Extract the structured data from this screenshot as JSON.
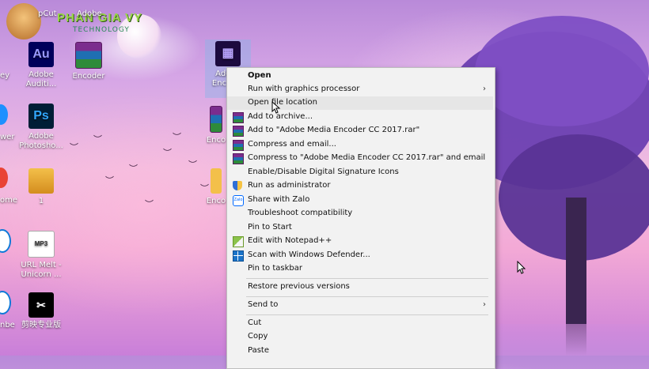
{
  "watermark": {
    "title": "PHAN GIA VY",
    "subtitle": "TECHNOLOGY"
  },
  "desktop_icons": [
    {
      "label": "pCut"
    },
    {
      "label": "Adobe"
    },
    {
      "label": "Adobe Auditi..."
    },
    {
      "label": "Encoder"
    },
    {
      "label": "Adobe Encod..."
    },
    {
      "label": "Adobe Photosho..."
    },
    {
      "label": "Enco"
    },
    {
      "label": "1"
    },
    {
      "label": "Enco"
    },
    {
      "label": "URL Melt - Unicorn ..."
    },
    {
      "label": "剪映专业版"
    },
    {
      "label": "ey"
    },
    {
      "label": "wer"
    },
    {
      "label": "ome"
    },
    {
      "label": "nbe"
    }
  ],
  "context_menu": {
    "items": [
      {
        "label": "Open",
        "icon": "",
        "bold": true
      },
      {
        "label": "Run with graphics processor",
        "icon": "",
        "submenu": true
      },
      {
        "label": "Open file location",
        "icon": "",
        "hover": true
      },
      {
        "label": "Add to archive...",
        "icon": "winrar-icon"
      },
      {
        "label": "Add to \"Adobe Media Encoder CC 2017.rar\"",
        "icon": "winrar-icon"
      },
      {
        "label": "Compress and email...",
        "icon": "winrar-icon"
      },
      {
        "label": "Compress to \"Adobe Media Encoder CC 2017.rar\" and email",
        "icon": "winrar-icon"
      },
      {
        "label": "Enable/Disable Digital Signature Icons",
        "icon": ""
      },
      {
        "label": "Run as administrator",
        "icon": "shield-icon"
      },
      {
        "label": "Share with Zalo",
        "icon": "zalo-icon"
      },
      {
        "label": "Troubleshoot compatibility",
        "icon": ""
      },
      {
        "label": "Pin to Start",
        "icon": ""
      },
      {
        "label": "Edit with Notepad++",
        "icon": "notepad-plus-plus-icon"
      },
      {
        "label": "Scan with Windows Defender...",
        "icon": "windows-defender-icon"
      },
      {
        "label": "Pin to taskbar",
        "icon": ""
      },
      {
        "label": "Restore previous versions",
        "icon": ""
      },
      {
        "label": "Send to",
        "icon": "",
        "submenu": true
      },
      {
        "label": "Cut",
        "icon": ""
      },
      {
        "label": "Copy",
        "icon": ""
      },
      {
        "label": "Paste",
        "icon": ""
      }
    ]
  },
  "colors": {
    "menu_bg": "#f2f2f2",
    "hover": "#e6e6e6",
    "tree": "#6b3fb1"
  }
}
